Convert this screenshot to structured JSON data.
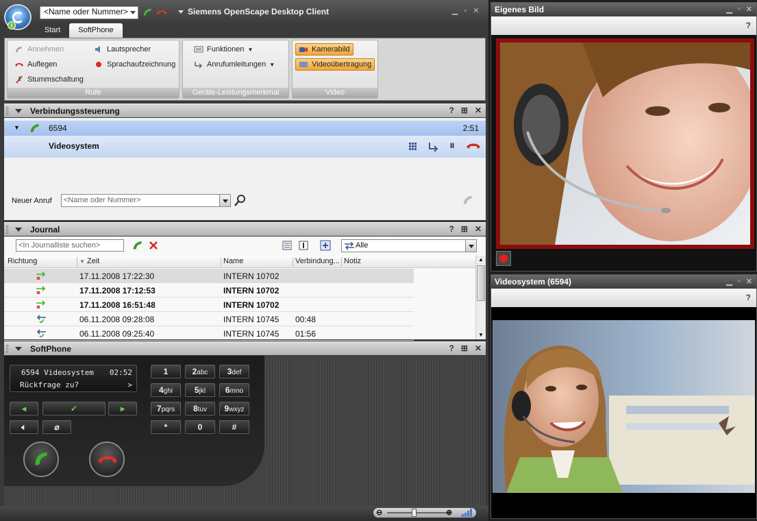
{
  "main_window": {
    "title": "Siemens OpenScape Desktop Client",
    "quick_dial_placeholder": "<Name oder Nummer>",
    "tabs": [
      "Start",
      "SoftPhone"
    ],
    "active_tab": "SoftPhone",
    "ribbon": {
      "calls_group": {
        "label": "Rufe",
        "answer": "Annehmen",
        "hangup": "Auflegen",
        "mute": "Stummschaltung",
        "speaker": "Lautsprecher",
        "record": "Sprachaufzeichnung"
      },
      "features_group": {
        "label": "Geräte-Leistungsmerkmal",
        "functions": "Funktionen",
        "forwarding": "Anrufumleitungen"
      },
      "video_group": {
        "label": "Video",
        "camera": "Kamerabild",
        "transmission": "Videoübertragung"
      }
    }
  },
  "connection_panel": {
    "title": "Verbindungssteuerung",
    "call_number": "6594",
    "call_duration": "2:51",
    "party_name": "Videosystem",
    "new_call_label": "Neuer Anruf",
    "new_call_placeholder": "<Name oder Nummer>"
  },
  "journal_panel": {
    "title": "Journal",
    "search_placeholder": "<In Journalliste suchen>",
    "filter_value": "Alle",
    "columns": [
      "Richtung",
      "Zeit",
      "Name",
      "Verbindung...",
      "Notiz"
    ],
    "rows": [
      {
        "time": "17.11.2008 17:22:30",
        "name": "INTERN 10702",
        "duration": "",
        "bold": false,
        "selected": true
      },
      {
        "time": "17.11.2008 17:12:53",
        "name": "INTERN 10702",
        "duration": "",
        "bold": true,
        "selected": false
      },
      {
        "time": "17.11.2008 16:51:48",
        "name": "INTERN 10702",
        "duration": "",
        "bold": true,
        "selected": false
      },
      {
        "time": "06.11.2008 09:28:08",
        "name": "INTERN 10745",
        "duration": "00:48",
        "bold": false,
        "selected": false
      },
      {
        "time": "06.11.2008 09:25:40",
        "name": "INTERN 10745",
        "duration": "01:56",
        "bold": false,
        "selected": false
      }
    ]
  },
  "softphone_panel": {
    "title": "SoftPhone",
    "lcd_line1_left": "6594 Videosystem",
    "lcd_line1_right": "02:52",
    "lcd_line2_left": "Rückfrage zu?",
    "lcd_line2_right": ">",
    "keys": [
      {
        "digit": "1",
        "letters": ""
      },
      {
        "digit": "2",
        "letters": "abc"
      },
      {
        "digit": "3",
        "letters": "def"
      },
      {
        "digit": "4",
        "letters": "ghi"
      },
      {
        "digit": "5",
        "letters": "jkl"
      },
      {
        "digit": "6",
        "letters": "mno"
      },
      {
        "digit": "7",
        "letters": "pqrs"
      },
      {
        "digit": "8",
        "letters": "tuv"
      },
      {
        "digit": "9",
        "letters": "wxyz"
      },
      {
        "digit": "*",
        "letters": ""
      },
      {
        "digit": "0",
        "letters": ""
      },
      {
        "digit": "#",
        "letters": ""
      }
    ]
  },
  "own_video_window": {
    "title": "Eigenes Bild",
    "help": "?"
  },
  "remote_video_window": {
    "title": "Videosystem (6594)",
    "help": "?"
  },
  "colors": {
    "accent_orange": "#f1a43b",
    "selection_blue": "#a4c0ec",
    "frame_red": "#8b0e0e"
  }
}
